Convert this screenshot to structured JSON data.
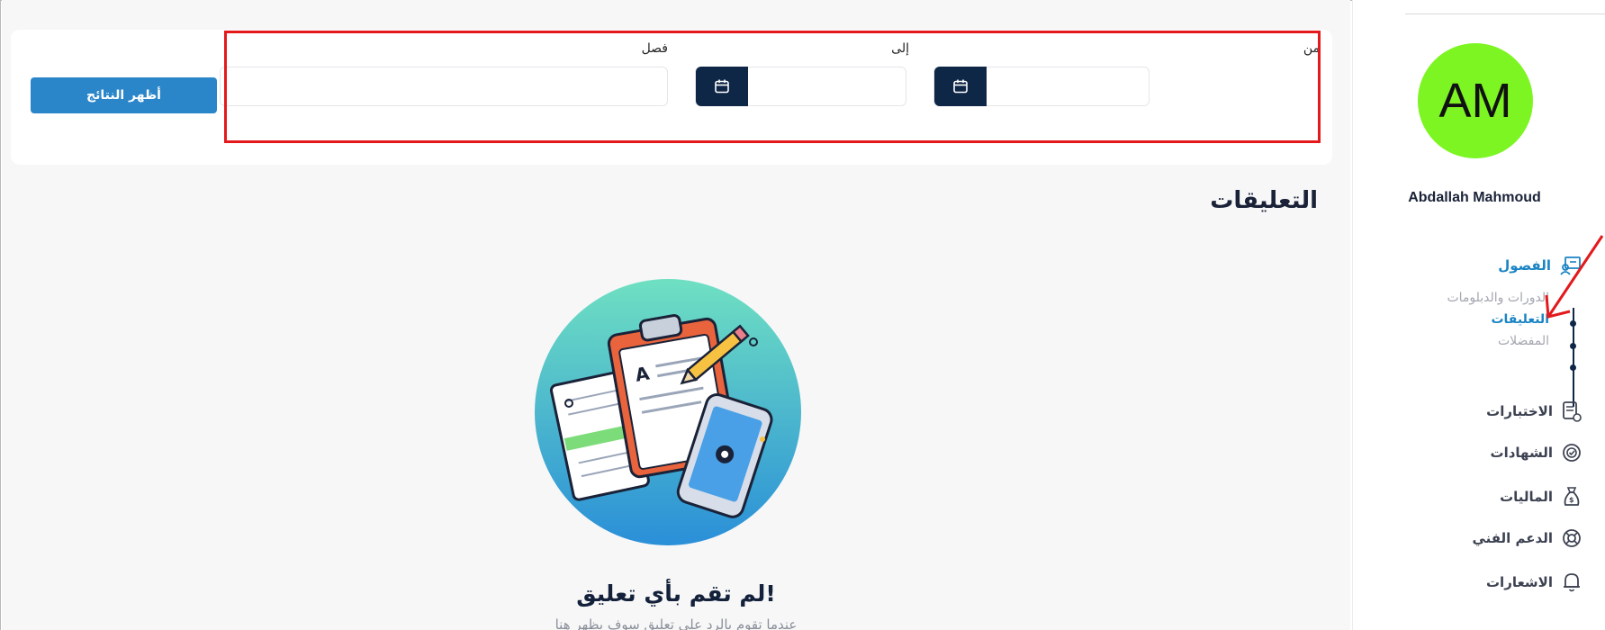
{
  "filters": {
    "from_label": "من",
    "to_label": "إلى",
    "chapter_label": "فصل",
    "show_results_button": "أظهر النتائج"
  },
  "main": {
    "title": "التعليقات",
    "empty_title": "لم تقم بأي تعليق!",
    "empty_subtitle": "عندما تقوم بالرد على تعليق سوف يظهر هنا"
  },
  "sidebar": {
    "avatar_initials": "AM",
    "user_name": "Abdallah Mahmoud",
    "chapters_label": "الفصول",
    "sub_items": [
      "الدورات والدبلومات",
      "التعليقات",
      "المفضلات"
    ],
    "exams_label": "الاختبارات",
    "certificates_label": "الشهادات",
    "finance_label": "الماليات",
    "support_label": "الدعم الفني",
    "notifications_label": "الاشعارات"
  },
  "colors": {
    "accent": "#1b84c4",
    "navy": "#0f2747",
    "highlight": "#e3191c",
    "avatar": "#7cf522"
  }
}
